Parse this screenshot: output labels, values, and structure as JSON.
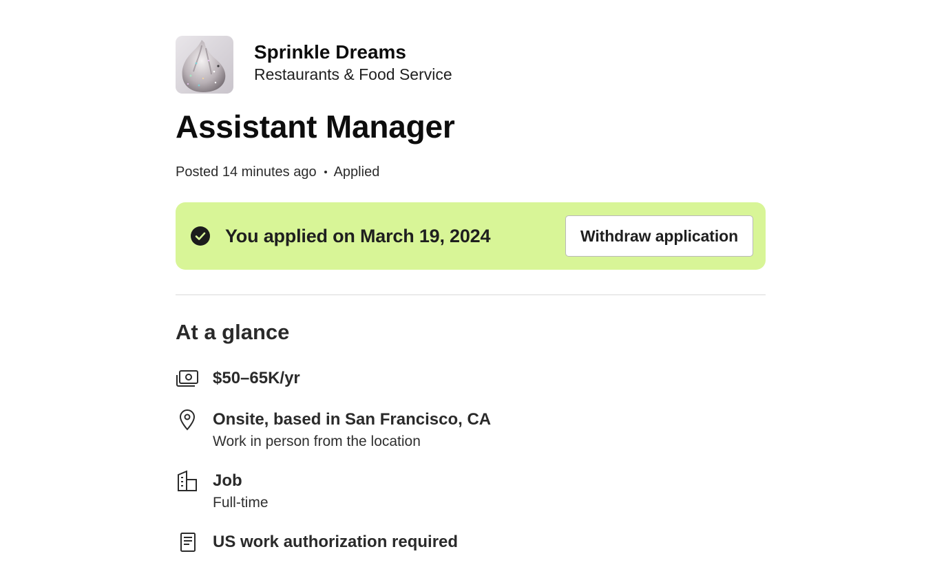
{
  "company": {
    "name": "Sprinkle Dreams",
    "industry": "Restaurants & Food Service",
    "logo_icon": "meringue-logo"
  },
  "job": {
    "title": "Assistant Manager",
    "posted": "Posted 14 minutes ago",
    "status": "Applied"
  },
  "application": {
    "message": "You applied on March 19, 2024",
    "withdraw_label": "Withdraw application",
    "banner_color": "#d8f597",
    "icon": "check-circle-icon"
  },
  "glance": {
    "heading": "At a glance",
    "items": [
      {
        "icon": "money-icon",
        "title": "$50–65K/yr",
        "subtitle": ""
      },
      {
        "icon": "location-pin-icon",
        "title": "Onsite, based in San Francisco, CA",
        "subtitle": "Work in person from the location"
      },
      {
        "icon": "building-icon",
        "title": "Job",
        "subtitle": "Full-time"
      },
      {
        "icon": "document-icon",
        "title": "US work authorization required",
        "subtitle": ""
      }
    ]
  }
}
